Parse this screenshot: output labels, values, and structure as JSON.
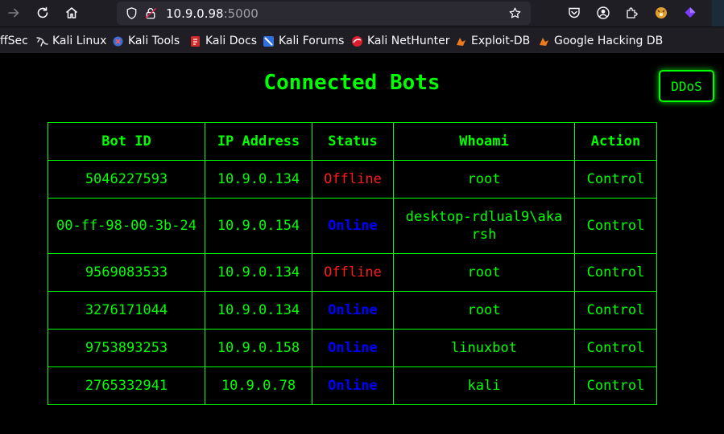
{
  "browser": {
    "url_host": "10.9.0.98",
    "url_port": ":5000",
    "bookmarks": [
      "ffSec",
      "Kali Linux",
      "Kali Tools",
      "Kali Docs",
      "Kali Forums",
      "Kali NetHunter",
      "Exploit-DB",
      "Google Hacking DB"
    ]
  },
  "page": {
    "title": "Connected Bots",
    "ddos_label": "DDoS"
  },
  "table": {
    "headers": [
      "Bot ID",
      "IP Address",
      "Status",
      "Whoami",
      "Action"
    ],
    "rows": [
      {
        "bot_id": "5046227593",
        "ip": "10.9.0.134",
        "status": "Offline",
        "whoami": "root",
        "action": "Control"
      },
      {
        "bot_id": "00-ff-98-00-3b-24",
        "ip": "10.9.0.154",
        "status": "Online",
        "whoami": "desktop-rdlual9\\akarsh",
        "action": "Control"
      },
      {
        "bot_id": "9569083533",
        "ip": "10.9.0.134",
        "status": "Offline",
        "whoami": "root",
        "action": "Control"
      },
      {
        "bot_id": "3276171044",
        "ip": "10.9.0.134",
        "status": "Online",
        "whoami": "root",
        "action": "Control"
      },
      {
        "bot_id": "9753893253",
        "ip": "10.9.0.158",
        "status": "Online",
        "whoami": "linuxbot",
        "action": "Control"
      },
      {
        "bot_id": "2765332941",
        "ip": "10.9.0.78",
        "status": "Online",
        "whoami": "kali",
        "action": "Control"
      }
    ]
  },
  "colors": {
    "accent": "#00ff00",
    "offline": "#ff1a1a",
    "online": "#0000ff",
    "background": "#000000"
  }
}
